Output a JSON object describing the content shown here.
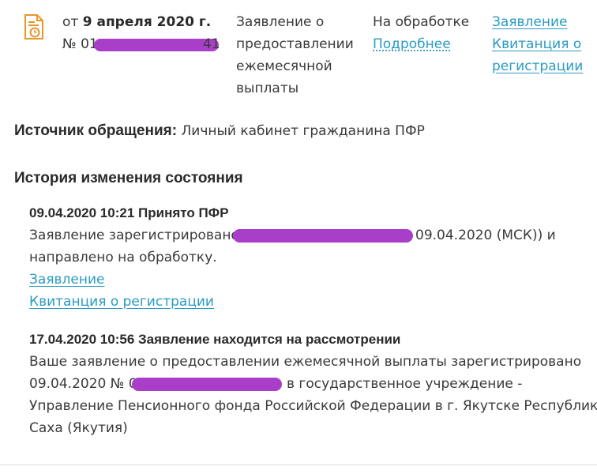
{
  "request": {
    "date_prefix": "от",
    "date": "9 апреля 2020 г.",
    "number_prefix": "№ 01",
    "number_suffix": "41",
    "title_lines": [
      "Заявление о",
      "предоставлении",
      "ежемесячной",
      "выплаты"
    ],
    "status": "На обработке",
    "details_link": "Подробнее",
    "links": [
      "Заявление",
      "Квитанция о",
      "регистрации"
    ]
  },
  "source": {
    "label": "Источник обращения:",
    "value": "Личный кабинет гражданина ПФР"
  },
  "history": {
    "title": "История изменения состояния",
    "entries": [
      {
        "header": "09.04.2020 10:21 Принято ПФР",
        "line1_start": "Заявление зарегистрировано (",
        "line1_end": "09.04.2020 (МСК)) и",
        "line2": "направлено на обработку.",
        "link1": "Заявление",
        "link2": "Квитанция о регистрации"
      },
      {
        "header": "17.04.2020 10:56 Заявление находится на рассмотрении",
        "line1": "Ваше заявление о предоставлении ежемесячной выплаты зарегистрировано",
        "line2_start": "09.04.2020 № 0",
        "line2_end": "в государственное учреждение -",
        "line3": "Управление Пенсионного фонда Российской Федерации в г. Якутске Республики",
        "line4": "Саха (Якутия)"
      }
    ]
  },
  "colors": {
    "link": "#2a9bc2",
    "icon": "#e8962a",
    "redaction": "#a93fc8"
  }
}
